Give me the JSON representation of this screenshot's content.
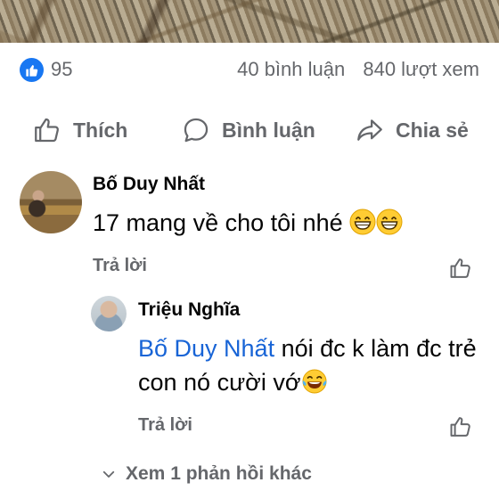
{
  "reactions": {
    "count": "95",
    "icon": "like-reaction-icon",
    "color": "#1877f2"
  },
  "stats": {
    "comments": "40 bình luận",
    "views": "840 lượt xem"
  },
  "actions": {
    "like_label": "Thích",
    "comment_label": "Bình luận",
    "share_label": "Chia sẻ"
  },
  "comments": [
    {
      "author": "Bố Duy Nhất",
      "text": "17 mang về cho tôi nhé",
      "emoji": [
        "grinning-face",
        "grinning-face"
      ],
      "reply_label": "Trả lời"
    },
    {
      "author": "Triệu Nghĩa",
      "mention": "Bố Duy Nhất",
      "text": " nói đc k làm đc trẻ con nó cười vớ",
      "emoji": [
        "face-with-tears-of-joy"
      ],
      "reply_label": "Trả lời"
    }
  ],
  "more_replies": "Xem 1 phản hồi khác"
}
